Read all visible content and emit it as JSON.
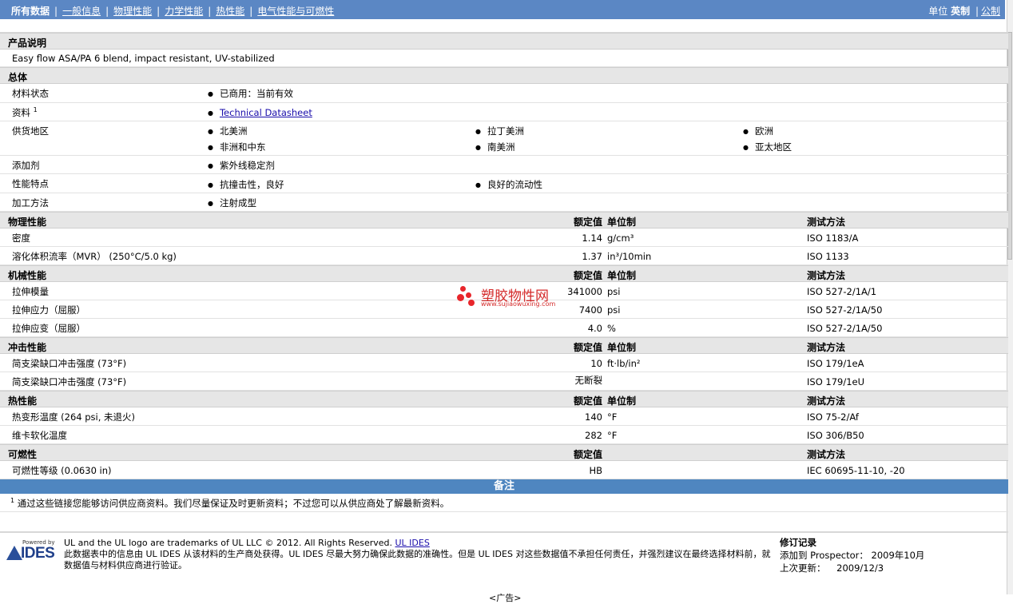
{
  "nav": {
    "all": "所有数据",
    "general": "一般信息",
    "physical": "物理性能",
    "mechanical": "力学性能",
    "thermal": "热性能",
    "electrical": "电气性能与可燃性",
    "units_label": "单位",
    "english": "英制",
    "metric": "公制",
    "sep": "|"
  },
  "product": {
    "title": "产品说明",
    "description": "Easy flow ASA/PA 6 blend, impact resistant, UV-stabilized"
  },
  "general": {
    "title": "总体",
    "status_label": "材料状态",
    "status_value": "已商用：当前有效",
    "docs_label": "资料",
    "docs_sup": "1",
    "docs_link": "Technical Datasheet",
    "regions_label": "供货地区",
    "regions": [
      "北美洲",
      "拉丁美洲",
      "欧洲",
      "非洲和中东",
      "南美洲",
      "亚太地区"
    ],
    "additives_label": "添加剂",
    "additives": [
      "紫外线稳定剂"
    ],
    "features_label": "性能特点",
    "features": [
      "抗撞击性，良好",
      "良好的流动性"
    ],
    "processing_label": "加工方法",
    "processing": [
      "注射成型"
    ]
  },
  "headers": {
    "nominal": "额定值",
    "unit": "单位制",
    "method": "测试方法"
  },
  "sections": [
    {
      "title": "物理性能",
      "rows": [
        {
          "label": "密度",
          "value": "1.14",
          "unit": "g/cm³",
          "method": "ISO 1183/A"
        },
        {
          "label": "溶化体积流率（MVR） (250°C/5.0 kg)",
          "value": "1.37",
          "unit": "in³/10min",
          "method": "ISO 1133"
        }
      ]
    },
    {
      "title": "机械性能",
      "rows": [
        {
          "label": "拉伸模量",
          "value": "341000",
          "unit": "psi",
          "method": "ISO 527-2/1A/1"
        },
        {
          "label": "拉伸应力（屈服）",
          "value": "7400",
          "unit": "psi",
          "method": "ISO 527-2/1A/50"
        },
        {
          "label": "拉伸应变（屈服）",
          "value": "4.0",
          "unit": "%",
          "method": "ISO 527-2/1A/50"
        }
      ]
    },
    {
      "title": "冲击性能",
      "rows": [
        {
          "label": "简支梁缺口冲击强度 (73°F)",
          "value": "10",
          "unit": "ft·lb/in²",
          "method": "ISO 179/1eA"
        },
        {
          "label": "简支梁缺口冲击强度 (73°F)",
          "value": "无断裂",
          "unit": "",
          "method": "ISO 179/1eU"
        }
      ]
    },
    {
      "title": "热性能",
      "rows": [
        {
          "label": "热变形温度 (264 psi, 未退火)",
          "value": "140",
          "unit": "°F",
          "method": "ISO 75-2/Af"
        },
        {
          "label": "维卡软化温度",
          "value": "282",
          "unit": "°F",
          "method": "ISO 306/B50"
        }
      ]
    },
    {
      "title": "可燃性",
      "rows": [
        {
          "label": "可燃性等级 (0.0630 in)",
          "value": "HB",
          "unit": "",
          "method": "IEC 60695-11-10, -20"
        }
      ]
    }
  ],
  "notes": {
    "title": "备注",
    "sup": "1",
    "text": "通过这些链接您能够访问供应商资料。我们尽量保证及时更新资料；不过您可以从供应商处了解最新资料。"
  },
  "footer": {
    "powered_by": "Powered by",
    "logo_text": "IDES",
    "line1": "UL and the UL logo are trademarks of UL LLC © 2012. All Rights Reserved.",
    "line1_link": "UL IDES",
    "line2": "此数据表中的信息由 UL IDES 从该材料的生产商处获得。UL IDES 尽最大努力确保此数据的准确性。但是 UL IDES 对这些数据值不承担任何责任，并强烈建议在最终选择材料前，就数据值与材料供应商进行验证。",
    "rev_title": "修订记录",
    "added_label": "添加到 Prospector：",
    "added_value": "2009年10月",
    "updated_label": "上次更新：",
    "updated_value": "2009/12/3",
    "ad": "<广告>"
  },
  "watermark": {
    "name": "塑胶物性网",
    "url": "www.sujiaowuxing.com"
  }
}
